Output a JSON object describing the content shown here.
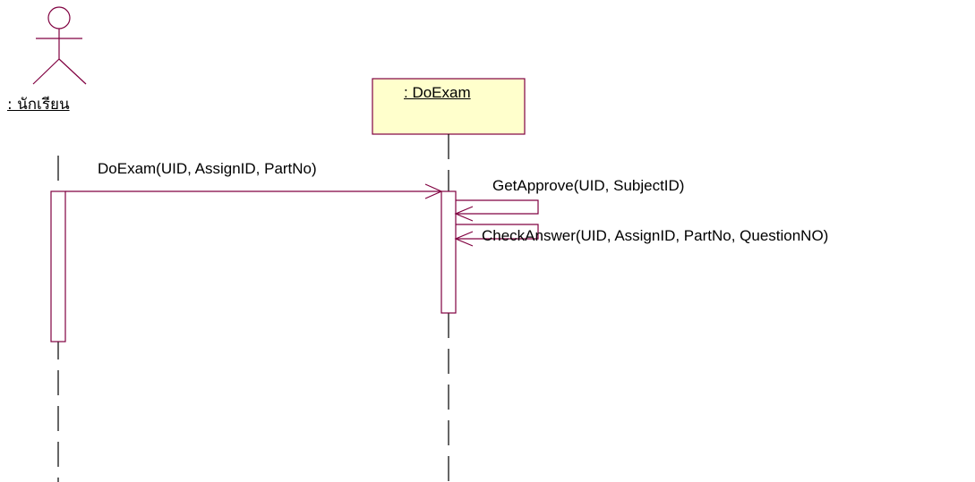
{
  "actor": {
    "name": ": นักเรียน",
    "icon": "stick-figure-actor-icon"
  },
  "object": {
    "name": ": DoExam"
  },
  "messages": [
    {
      "label": "DoExam(UID, AssignID, PartNo)"
    },
    {
      "label": "GetApprove(UID, SubjectID)"
    },
    {
      "label": "CheckAnswer(UID, AssignID, PartNo, QuestionNO)"
    }
  ],
  "colors": {
    "line": "#800040",
    "object_fill": "#ffffcc",
    "lifeline": "#000000",
    "text": "#000000"
  }
}
